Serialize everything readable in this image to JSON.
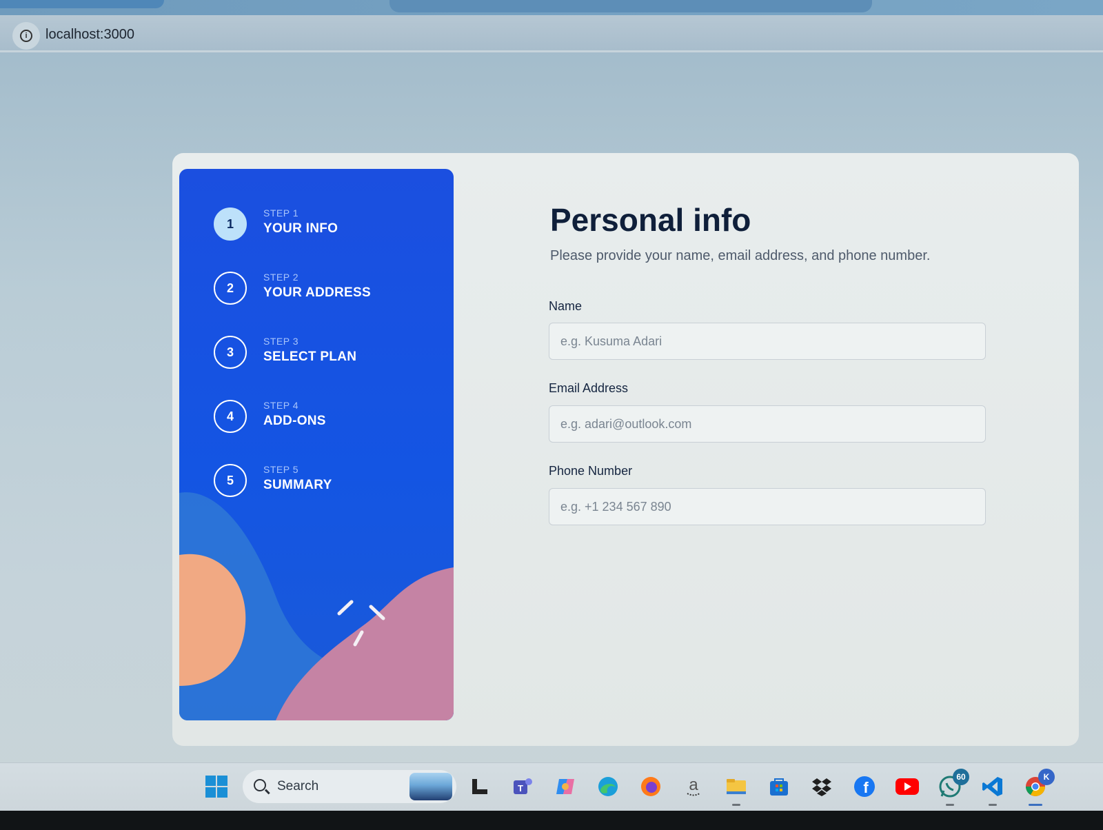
{
  "browser": {
    "url": "localhost:3000"
  },
  "sidebar": {
    "steps": [
      {
        "number": "1",
        "step_label": "STEP 1",
        "title": "YOUR INFO",
        "active": true
      },
      {
        "number": "2",
        "step_label": "STEP 2",
        "title": "YOUR ADDRESS",
        "active": false
      },
      {
        "number": "3",
        "step_label": "STEP 3",
        "title": "SELECT PLAN",
        "active": false
      },
      {
        "number": "4",
        "step_label": "STEP 4",
        "title": "ADD-ONS",
        "active": false
      },
      {
        "number": "5",
        "step_label": "STEP 5",
        "title": "SUMMARY",
        "active": false
      }
    ]
  },
  "form": {
    "title": "Personal info",
    "subtitle": "Please provide your name, email address, and phone number.",
    "fields": {
      "name": {
        "label": "Name",
        "placeholder": "e.g. Kusuma Adari",
        "value": ""
      },
      "email": {
        "label": "Email Address",
        "placeholder": "e.g. adari@outlook.com",
        "value": ""
      },
      "phone": {
        "label": "Phone Number",
        "placeholder": "e.g. +1 234 567 890",
        "value": ""
      }
    }
  },
  "taskbar": {
    "search_label": "Search",
    "whatsapp_badge": "60",
    "chrome_profile_initial": "K",
    "amazon_glyph": "a",
    "colors": {
      "sidebar_blue": "#1455e3",
      "active_step_fill": "#bde1fa",
      "title_navy": "#0f1f3a"
    }
  }
}
